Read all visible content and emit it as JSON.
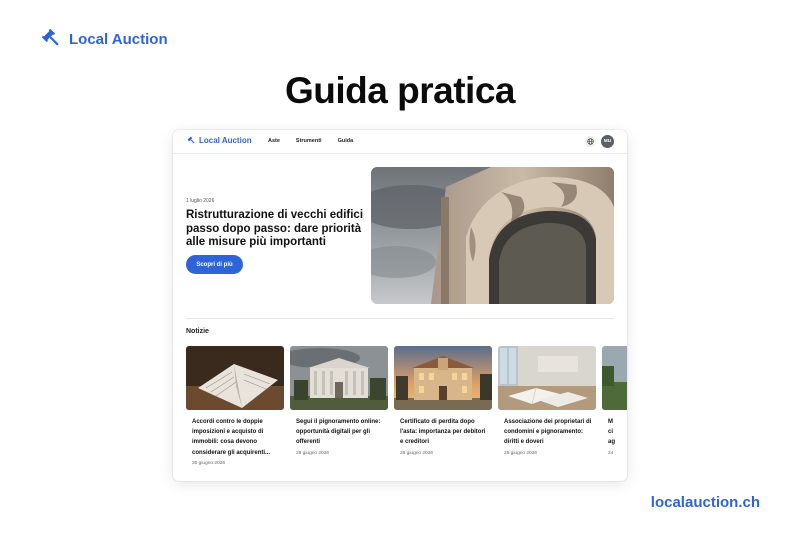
{
  "brand": {
    "name": "Local Auction",
    "icon": "gavel-icon",
    "color": "#2f64d8"
  },
  "headline": "Guida pratica",
  "site_url": "localauction.ch",
  "preview": {
    "nav": {
      "logo": "Local Auction",
      "links": [
        "Aste",
        "Strumenti",
        "Guida"
      ],
      "globe_icon": "globe-icon",
      "avatar_initials": "MU"
    },
    "hero": {
      "date": "1 luglio 2026",
      "title": "Ristrutturazione di vecchi edifici passo dopo passo: dare priorità alle misure più importanti",
      "button": "Scopri di più",
      "image": "old-building-arch-photo"
    },
    "news": {
      "heading": "Notizie",
      "items": [
        {
          "title": "Accordi contro le doppie imposizioni e acquisto di immobili: cosa devono considerare gli acquirenti...",
          "date": "30 giugno 2026",
          "image": "open-book-photo"
        },
        {
          "title": "Segui il pignoramento online: opportunità digitali per gli offerenti",
          "date": "29 giugno 2026",
          "image": "classical-building-photo"
        },
        {
          "title": "Certificato di perdita dopo l'asta: importanza per debitori e creditori",
          "date": "26 giugno 2026",
          "image": "villa-sunset-photo"
        },
        {
          "title": "Associazione dei proprietari di condomini e pignoramento: diritti e doveri",
          "date": "25 giugno 2026",
          "image": "documents-on-table-photo"
        },
        {
          "title": "M\nci\nag",
          "date": "24",
          "image": "landscape-photo"
        }
      ]
    }
  }
}
